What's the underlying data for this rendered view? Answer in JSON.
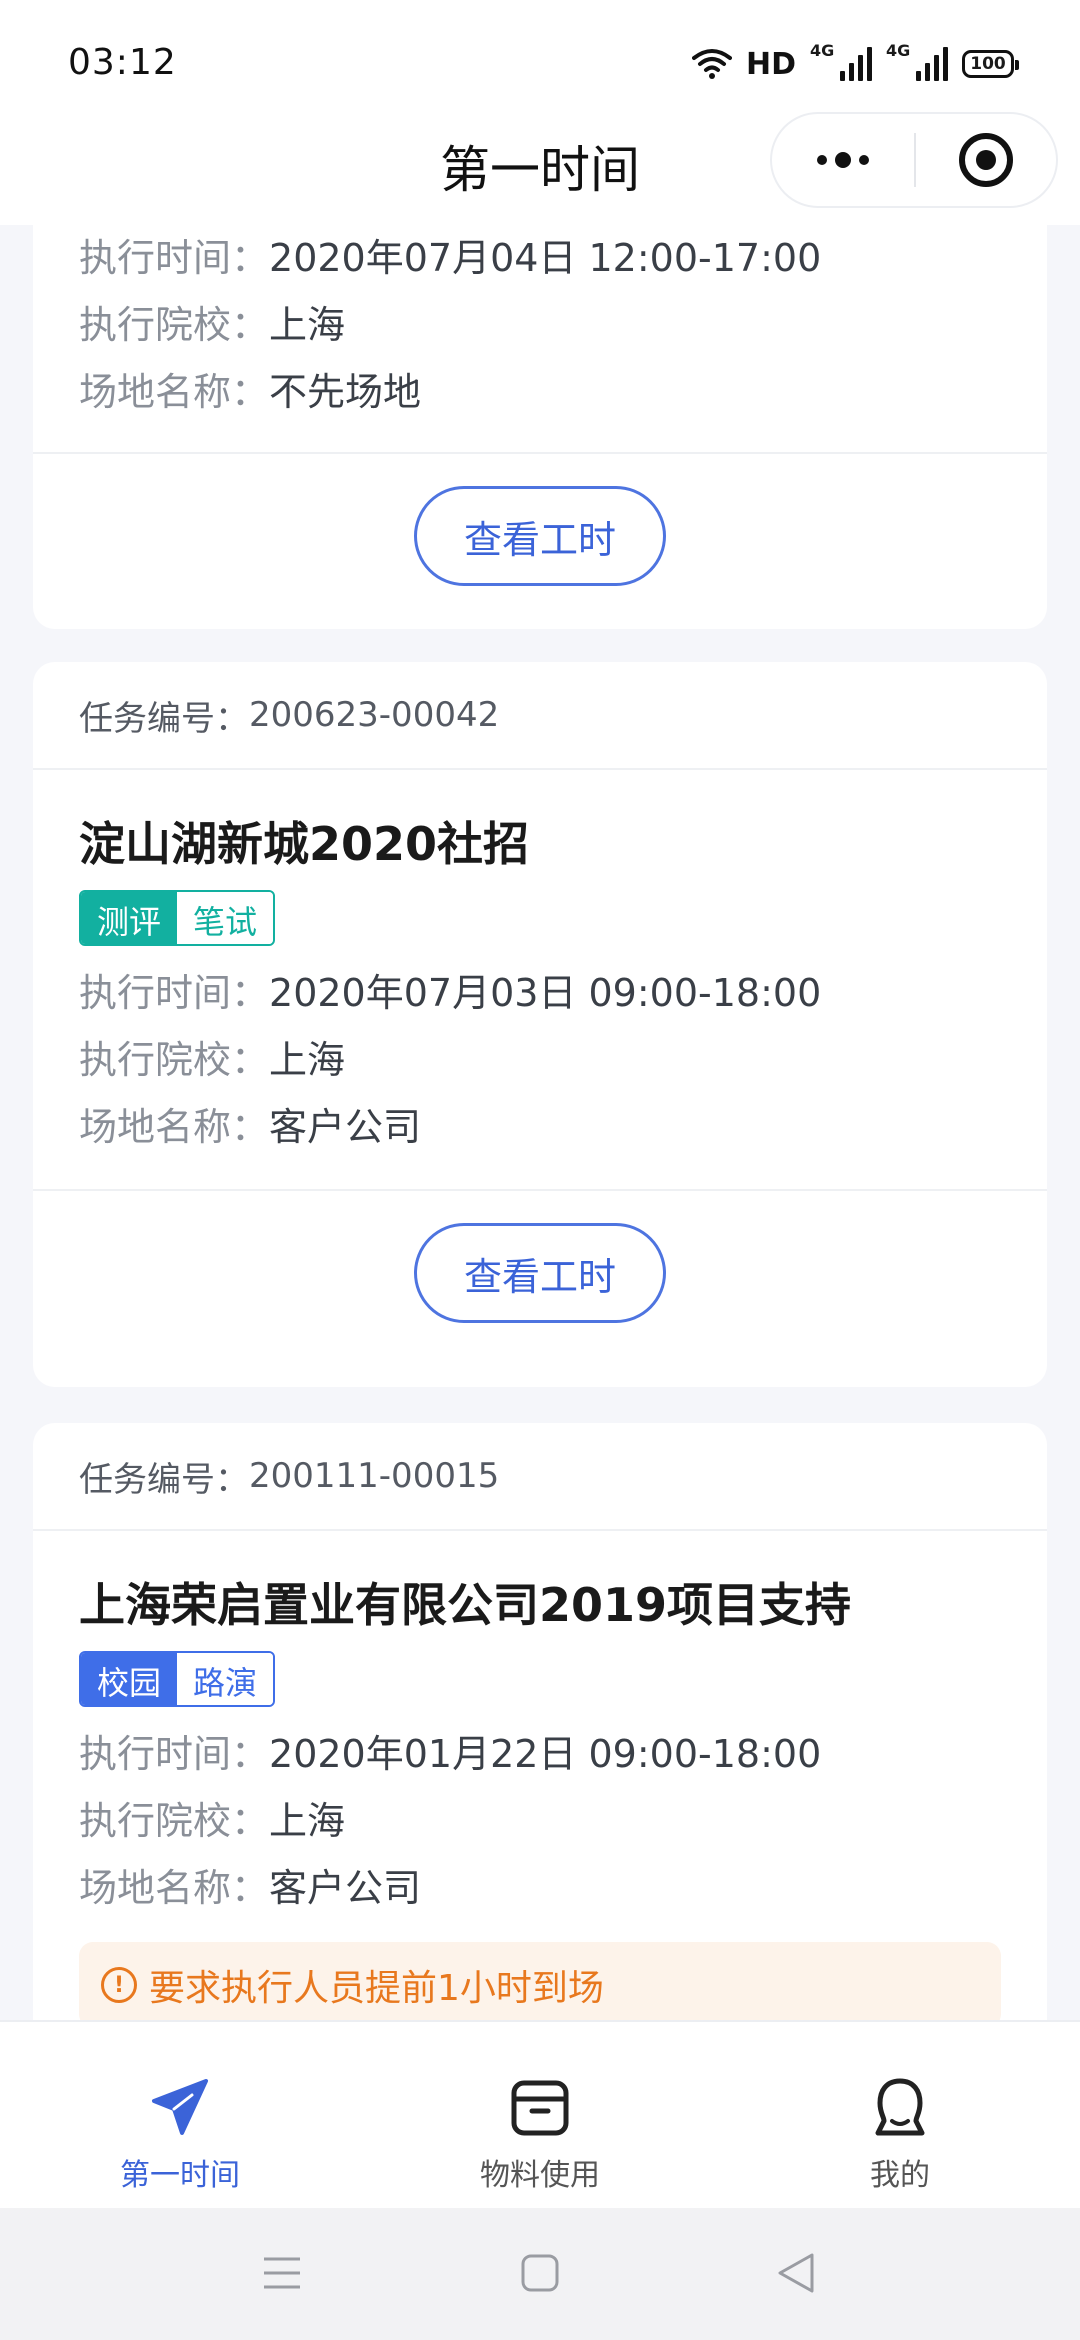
{
  "status_bar": {
    "time": "03:12",
    "hd_label": "HD",
    "network_1": "4G",
    "network_2": "4G",
    "battery": "100"
  },
  "nav": {
    "title": "第一时间"
  },
  "cards": [
    {
      "exec_time_label": "执行时间：",
      "exec_time": "2020年07月04日 12:00-17:00",
      "school_label": "执行院校：",
      "school": "上海",
      "venue_label": "场地名称：",
      "venue": "不先场地",
      "button_label": "查看工时"
    },
    {
      "task_no_label": "任务编号：",
      "task_no": "200623-00042",
      "title": "淀山湖新城2020社招",
      "tags": [
        {
          "text": "测评",
          "color": "#12b0a0",
          "filled": true
        },
        {
          "text": "笔试",
          "color": "#12b0a0",
          "filled": false
        }
      ],
      "exec_time_label": "执行时间：",
      "exec_time": "2020年07月03日 09:00-18:00",
      "school_label": "执行院校：",
      "school": "上海",
      "venue_label": "场地名称：",
      "venue": "客户公司",
      "button_label": "查看工时"
    },
    {
      "task_no_label": "任务编号：",
      "task_no": "200111-00015",
      "title": "上海荣启置业有限公司2019项目支持",
      "tags": [
        {
          "text": "校园",
          "color": "#3f6ee8",
          "filled": true
        },
        {
          "text": "路演",
          "color": "#3f6ee8",
          "filled": false
        }
      ],
      "exec_time_label": "执行时间：",
      "exec_time": "2020年01月22日 09:00-18:00",
      "school_label": "执行院校：",
      "school": "上海",
      "venue_label": "场地名称：",
      "venue": "客户公司",
      "notice": "要求执行人员提前1小时到场",
      "notice_icon": "!"
    }
  ],
  "tab_bar": {
    "items": [
      {
        "label": "第一时间",
        "icon": "paper-plane-icon",
        "active": true
      },
      {
        "label": "物料使用",
        "icon": "box-icon",
        "active": false
      },
      {
        "label": "我的",
        "icon": "person-icon",
        "active": false
      }
    ]
  },
  "colors": {
    "accent": "#3b63d8",
    "teal": "#12b0a0",
    "warning": "#e8781e"
  }
}
